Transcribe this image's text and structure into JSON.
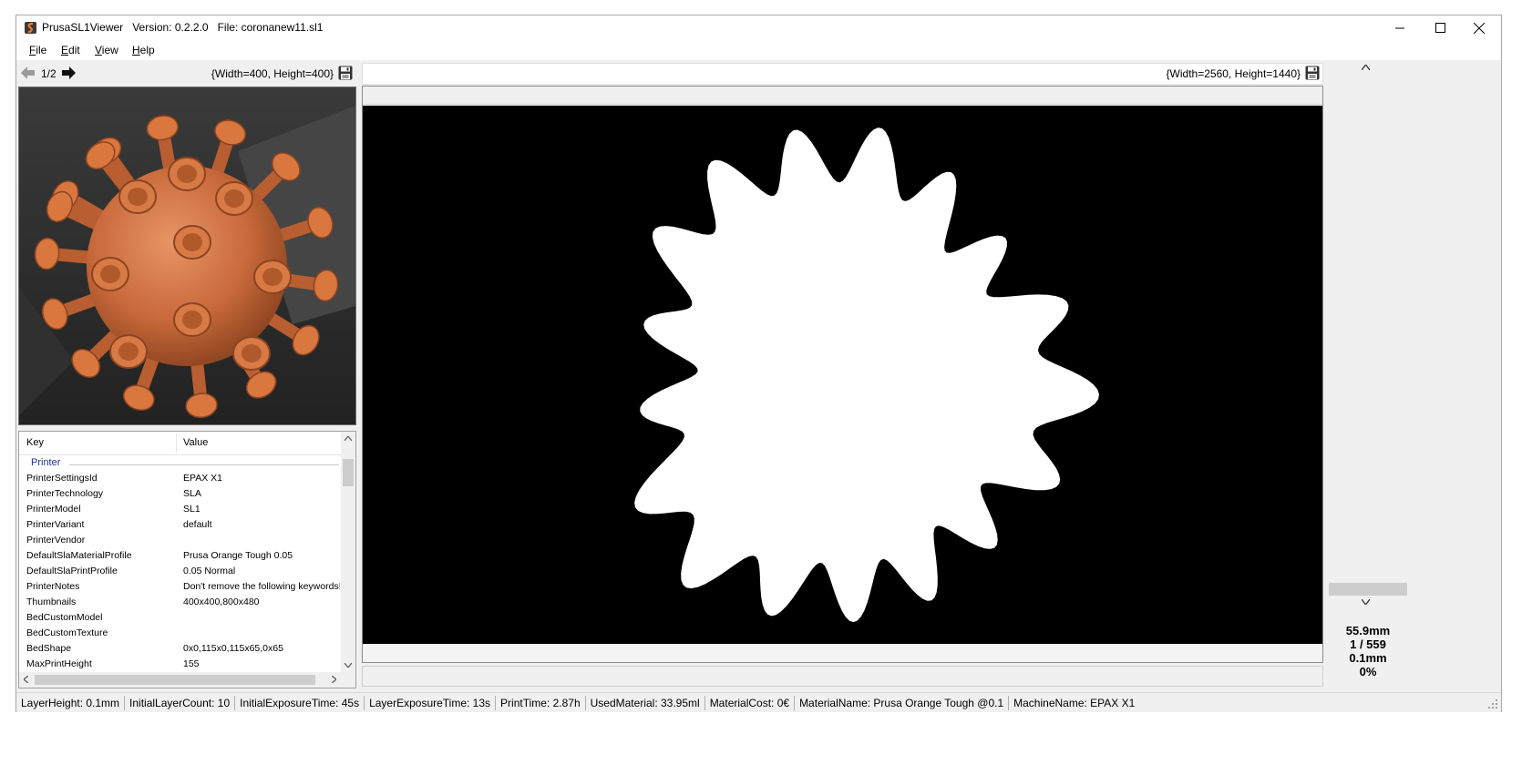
{
  "window": {
    "app_name": "PrusaSL1Viewer",
    "version": "Version: 0.2.2.0",
    "file": "File: coronanew11.sl1"
  },
  "menu": [
    "File",
    "Edit",
    "View",
    "Help"
  ],
  "thumbnails": {
    "page": "1/2",
    "size": "{Width=400, Height=400}"
  },
  "layer": {
    "size": "{Width=2560, Height=1440}",
    "height_mm": "55.9mm",
    "index": "1 / 559",
    "layer_height": "0.1mm",
    "progress": "0%"
  },
  "properties": {
    "headers": {
      "key": "Key",
      "value": "Value"
    },
    "group": "Printer",
    "rows": [
      {
        "key": "PrinterSettingsId",
        "value": "EPAX X1"
      },
      {
        "key": "PrinterTechnology",
        "value": "SLA"
      },
      {
        "key": "PrinterModel",
        "value": "SL1"
      },
      {
        "key": "PrinterVariant",
        "value": "default"
      },
      {
        "key": "PrinterVendor",
        "value": ""
      },
      {
        "key": "DefaultSlaMaterialProfile",
        "value": "Prusa Orange Tough 0.05"
      },
      {
        "key": "DefaultSlaPrintProfile",
        "value": "0.05 Normal"
      },
      {
        "key": "PrinterNotes",
        "value": "Don't remove the following keywords! ..."
      },
      {
        "key": "Thumbnails",
        "value": "400x400,800x480"
      },
      {
        "key": "BedCustomModel",
        "value": ""
      },
      {
        "key": "BedCustomTexture",
        "value": ""
      },
      {
        "key": "BedShape",
        "value": "0x0,115x0,115x65,0x65"
      },
      {
        "key": "MaxPrintHeight",
        "value": "155"
      }
    ]
  },
  "status": [
    "LayerHeight: 0.1mm",
    "InitialLayerCount: 10",
    "InitialExposureTime: 45s",
    "LayerExposureTime: 13s",
    "PrintTime: 2.87h",
    "UsedMaterial: 33.95ml",
    "MaterialCost: 0€",
    "MaterialName: Prusa Orange Tough @0.1",
    "MachineName: EPAX X1"
  ],
  "colors": {
    "model": "#d9773f",
    "layer_background": "#000000",
    "layer_fill": "#ffffff",
    "group_header": "#1e3287"
  },
  "icons": [
    "app-icon",
    "arrow-left-icon",
    "arrow-right-icon",
    "save-icon",
    "chevron-up-icon",
    "chevron-down-icon"
  ]
}
